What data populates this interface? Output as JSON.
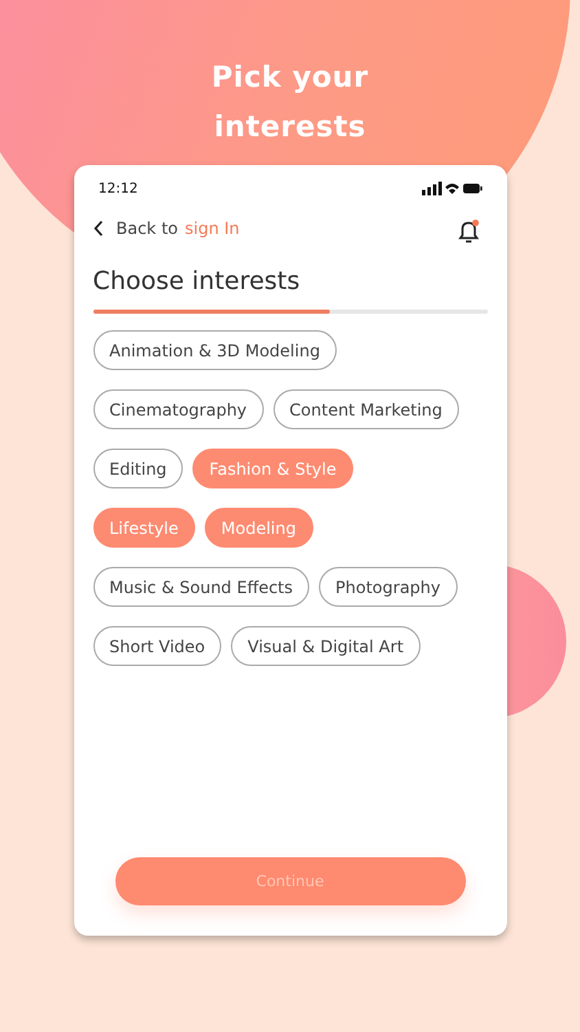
{
  "headline": "Pick your interests",
  "status_bar": {
    "time": "12:12"
  },
  "nav": {
    "back_text": "Back to",
    "back_link": "sign In",
    "notification_dot": true
  },
  "title": "Choose interests",
  "progress": {
    "level": 0.6
  },
  "chip_rows": [
    [
      {
        "label": "Animation & 3D Modeling",
        "selected": false
      }
    ],
    [
      {
        "label": "Cinematography",
        "selected": false
      },
      {
        "label": "Content Marketing",
        "selected": false
      }
    ],
    [
      {
        "label": "Editing",
        "selected": false
      },
      {
        "label": "Fashion & Style",
        "selected": true
      }
    ],
    [
      {
        "label": "Lifestyle",
        "selected": true
      },
      {
        "label": "Modeling",
        "selected": true
      }
    ],
    [
      {
        "label": "Music & Sound Effects",
        "selected": false
      },
      {
        "label": "Photography",
        "selected": false
      }
    ],
    [
      {
        "label": "Short Video",
        "selected": false
      },
      {
        "label": "Visual & Digital Art",
        "selected": false
      }
    ]
  ],
  "continue_button": "Continue"
}
